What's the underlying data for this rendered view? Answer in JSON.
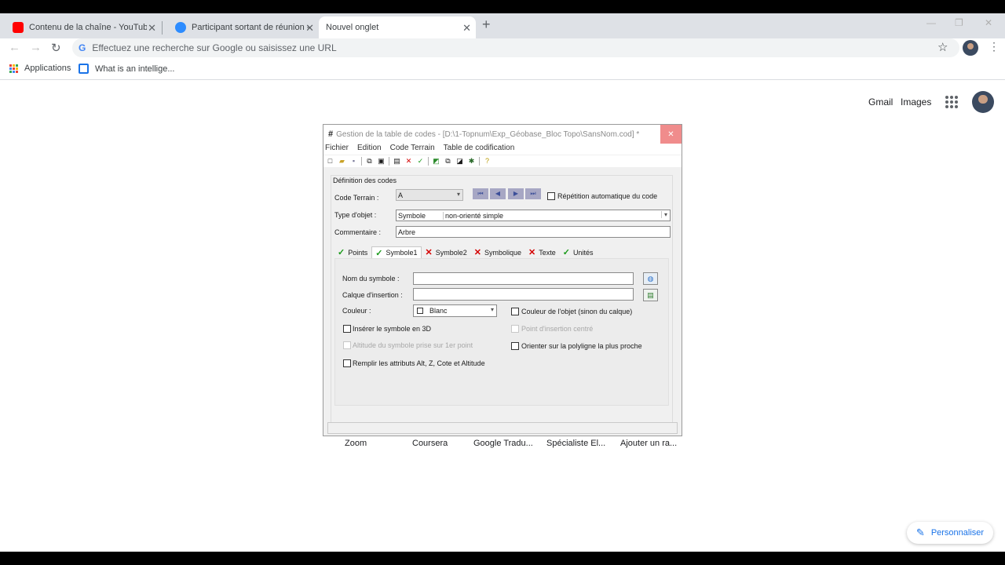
{
  "browser": {
    "tabs": [
      {
        "title": "Contenu de la chaîne - YouTube",
        "icon": "youtube-icon",
        "color": "#ff0000"
      },
      {
        "title": "Participant sortant de réunion - Z",
        "icon": "zoom-icon",
        "color": "#2d8cff"
      },
      {
        "title": "Nouvel onglet",
        "icon": "",
        "color": ""
      }
    ],
    "new_tab_symbol": "+",
    "window_controls": {
      "minimize": "—",
      "restore": "❐",
      "close": "✕"
    },
    "nav": {
      "back": "←",
      "forward": "→",
      "reload": "↻"
    },
    "omnibox_placeholder": "Effectuez une recherche sur Google ou saisissez une URL",
    "google_g": "G",
    "star": "☆",
    "kebab": "⋮",
    "bookmarks": [
      {
        "label": "Applications",
        "icon": "apps-grid-icon"
      },
      {
        "label": "What is an intellige...",
        "icon": "bookmark-page-icon"
      }
    ]
  },
  "newtab_page": {
    "gmail": "Gmail",
    "images": "Images",
    "shortcuts": [
      "Zoom",
      "Coursera",
      "Google Tradu...",
      "Spécialiste El...",
      "Ajouter un ra..."
    ],
    "personalize": "Personnaliser",
    "personalize_icon": "✎"
  },
  "dialog": {
    "app_icon": "#",
    "title": "Gestion de la table de codes - [D:\\1-Topnum\\Exp_Géobase_Bloc Topo\\SansNom.cod] *",
    "close": "✕",
    "menu": [
      "Fichier",
      "Edition",
      "Code Terrain",
      "Table de codification"
    ],
    "group_label": "Définition des codes",
    "code_terrain": {
      "label": "Code Terrain :",
      "value": "A"
    },
    "nav_buttons": [
      "⏮",
      "◀",
      "▶",
      "⏭"
    ],
    "repetition": {
      "label": "Répétition automatique du code",
      "checked": false
    },
    "type_objet": {
      "label": "Type d'objet :",
      "value1": "Symbole",
      "value2": "non-orienté simple"
    },
    "commentaire": {
      "label": "Commentaire :",
      "value": "Arbre"
    },
    "tabs": [
      {
        "label": "Points",
        "status": "ok"
      },
      {
        "label": "Symbole1",
        "status": "ok"
      },
      {
        "label": "Symbole2",
        "status": "ko"
      },
      {
        "label": "Symbolique",
        "status": "ko"
      },
      {
        "label": "Texte",
        "status": "ko"
      },
      {
        "label": "Unités",
        "status": "ok"
      }
    ],
    "ok_mark": "✓",
    "ko_mark": "✕",
    "panel": {
      "nom_symbole": {
        "label": "Nom du symbole :",
        "value": ""
      },
      "calque_insertion": {
        "label": "Calque d'insertion :",
        "value": ""
      },
      "couleur": {
        "label": "Couleur :",
        "value": "Blanc"
      },
      "couleur_objet": {
        "label": "Couleur de l'objet (sinon du calque)",
        "checked": false
      },
      "inserer_3d": {
        "label": "Insérer le symbole en 3D",
        "checked": false
      },
      "point_insertion": {
        "label": "Point d'insertion centré",
        "checked": false,
        "disabled": true
      },
      "altitude": {
        "label": "Altitude du symbole prise sur 1er point",
        "checked": false,
        "disabled": true
      },
      "orienter": {
        "label": "Orienter sur la polyligne la plus proche",
        "checked": false
      },
      "remplir": {
        "label": "Remplir les attributs Alt, Z, Cote et Altitude",
        "checked": false
      }
    }
  }
}
